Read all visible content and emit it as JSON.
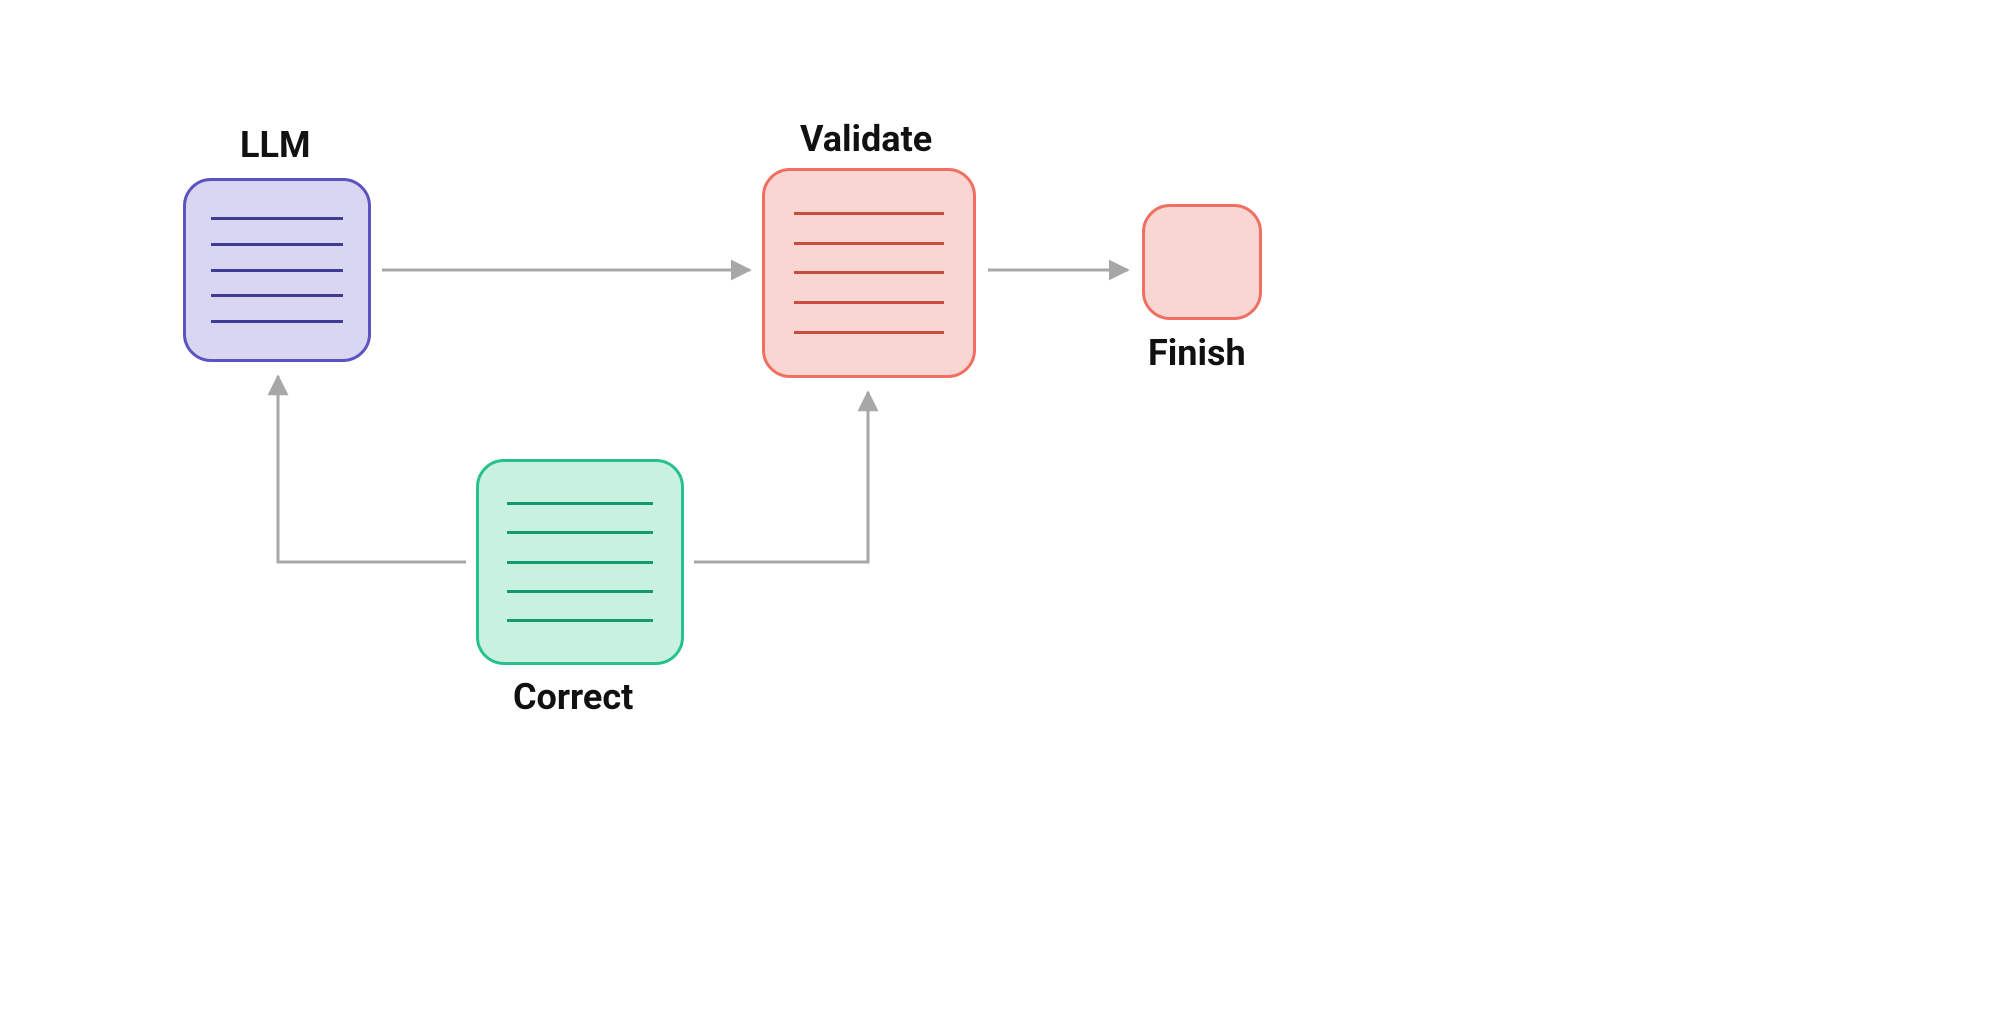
{
  "nodes": {
    "llm": {
      "label": "LLM"
    },
    "validate": {
      "label": "Validate"
    },
    "correct": {
      "label": "Correct"
    },
    "finish": {
      "label": "Finish"
    }
  },
  "edges": [
    {
      "from": "llm",
      "to": "validate"
    },
    {
      "from": "validate",
      "to": "finish"
    },
    {
      "from": "correct",
      "to": "llm"
    },
    {
      "from": "correct",
      "to": "validate"
    }
  ]
}
